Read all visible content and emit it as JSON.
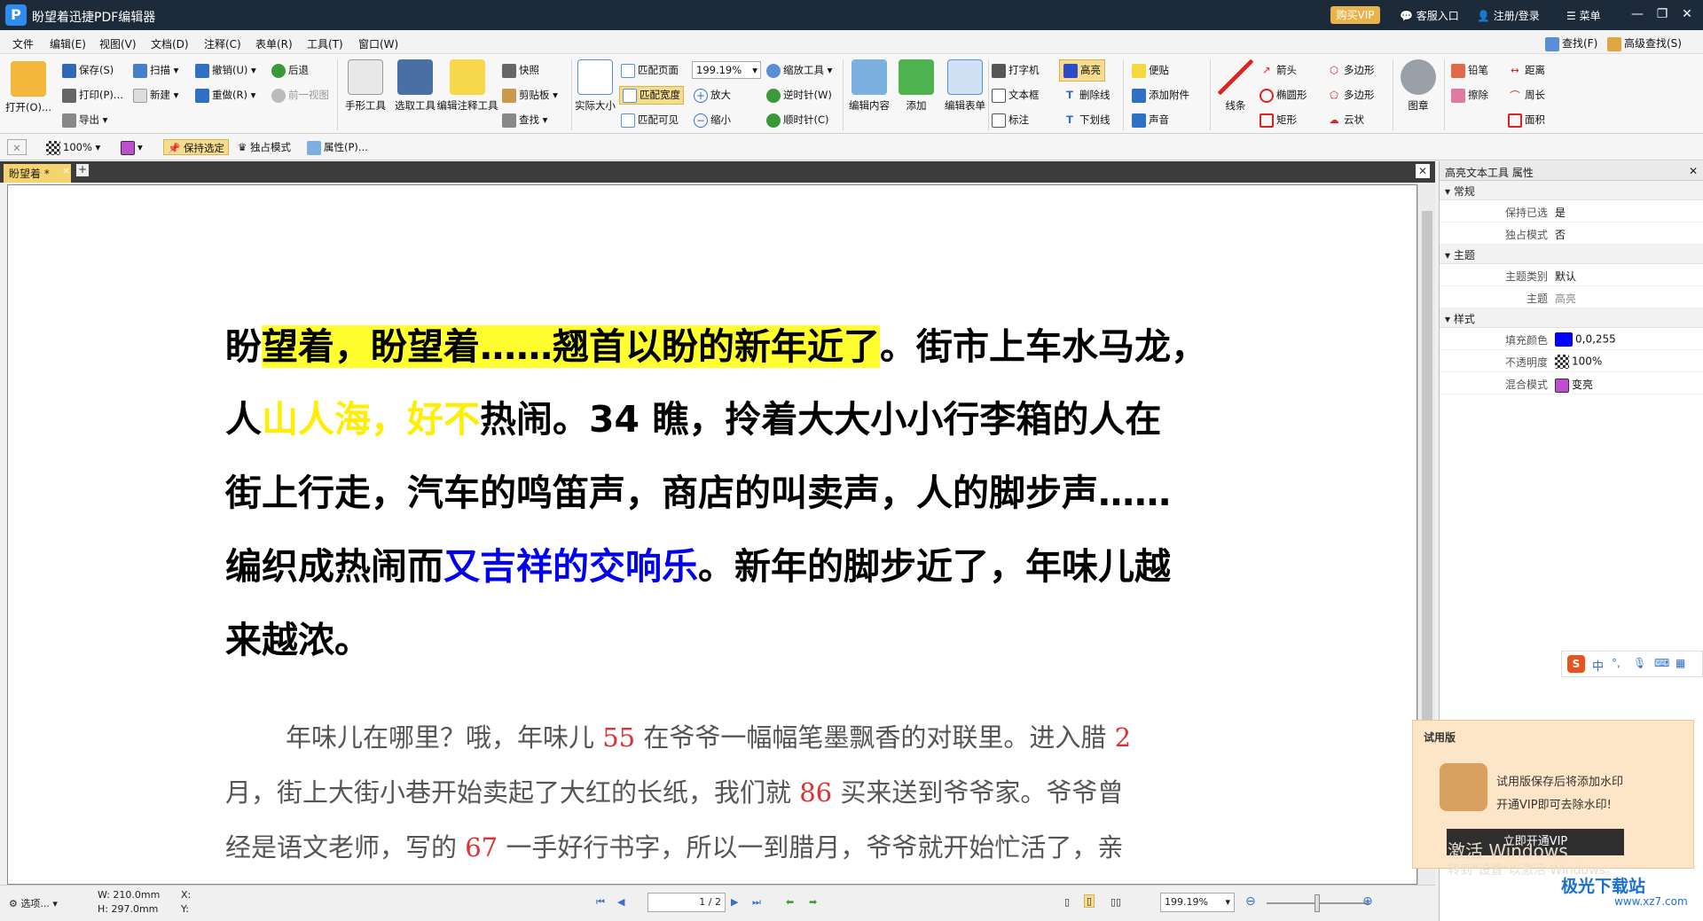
{
  "titlebar": {
    "app_title": "盼望着迅捷PDF编辑器",
    "buy_vip": "购买VIP",
    "support": "客服入口",
    "login": "注册/登录",
    "menu": "菜单"
  },
  "menubar": {
    "items": [
      "文件",
      "编辑(E)",
      "视图(V)",
      "文档(D)",
      "注释(C)",
      "表单(R)",
      "工具(T)",
      "窗口(W)"
    ],
    "find": "查找(F)",
    "advanced_find": "高级查找(S)"
  },
  "ribbon": {
    "open": "打开(O)...",
    "save": "保存(S)",
    "print": "打印(P)...",
    "export": "导出",
    "scan": "扫描",
    "new": "新建",
    "undo": "撤销(U)",
    "redo": "重做(R)",
    "back": "后退",
    "prev_view": "前一视图",
    "hand_tool": "手形工具",
    "select_tool": "选取工具",
    "edit_annot_tool": "编辑注释工具",
    "snapshot": "快照",
    "clipboard": "剪贴板",
    "find": "查找",
    "actual_size": "实际大小",
    "fit_page": "匹配页面",
    "fit_width": "匹配宽度",
    "fit_visible": "匹配可见",
    "zoom_value": "199.19%",
    "zoom_in": "放大",
    "zoom_out": "缩小",
    "zoom_tool": "缩放工具",
    "rotate_ccw": "逆时针(W)",
    "rotate_cw": "顺时针(C)",
    "edit_content": "编辑内容",
    "add": "添加",
    "edit_form": "编辑表单",
    "typewriter": "打字机",
    "textbox": "文本框",
    "callout": "标注",
    "highlight": "高亮",
    "strikeout": "删除线",
    "underline": "下划线",
    "note": "便贴",
    "attach": "添加附件",
    "sound": "声音",
    "lines": "线条",
    "arrow": "箭头",
    "ellipse": "椭圆形",
    "rect": "矩形",
    "polygon": "多边形",
    "polyline": "多边形",
    "cloud": "云状",
    "stamp": "图章",
    "pencil": "铅笔",
    "eraser": "擦除",
    "distance": "距离",
    "perimeter": "周长",
    "area": "面积"
  },
  "prop_toolbar": {
    "opacity": "100%",
    "keep_selected": "保持选定",
    "exclusive_mode": "独占模式",
    "properties": "属性(P)..."
  },
  "doc_tab": {
    "label": "盼望着 *"
  },
  "document": {
    "line1_pre": "盼",
    "line1_hl": "望着，盼望着……翘首以盼的新年近了",
    "line1_post": "。街市上车水马龙，",
    "line2_pre": "人",
    "line2_yel": "山人海，好不",
    "line2_post": "热闹。34 瞧，拎着大大小小行李箱的人在",
    "line3": "街上行走，汽车的鸣笛声，商店的叫卖声，人的脚步声……",
    "line4_pre": "编织成热闹而",
    "line4_blue": "又吉祥的交响乐",
    "line4_post": "。新年的脚步近了，年味儿越",
    "line5": "来越浓。",
    "p1_a": "年味儿在哪里？哦，年味儿 ",
    "p1_n1": "55",
    "p1_b": " 在爷爷一幅幅笔墨飘香的对联里。进入腊 ",
    "p1_n2": "2",
    "p2_a": "月，街上大街小巷开始卖起了大红的长纸，我们就 ",
    "p2_n": "86",
    "p2_b": " 买来送到爷爷家。爷爷曾",
    "p3_a": "经是语文老师，写的 ",
    "p3_n": "67",
    "p3_b": " 一手好行书字，所以一到腊月，爷爷就开始忙活了，亲"
  },
  "statusbar": {
    "options": "选项...",
    "width": "W: 210.0mm",
    "height": "H: 297.0mm",
    "x": "X:",
    "y": "Y:",
    "page": "1",
    "page_total": "/ 2",
    "zoom": "199.19%"
  },
  "right_panel": {
    "title": "高亮文本工具 属性",
    "groups": [
      {
        "name": "常规",
        "rows": [
          {
            "k": "保持已选",
            "v": "是"
          },
          {
            "k": "独占模式",
            "v": "否"
          }
        ]
      },
      {
        "name": "主题",
        "rows": [
          {
            "k": "主题类别",
            "v": "默认"
          },
          {
            "k": "主题",
            "v": "高亮"
          }
        ]
      },
      {
        "name": "样式",
        "rows": [
          {
            "k": "填充颜色",
            "v": "0,0,255"
          },
          {
            "k": "不透明度",
            "v": "100%"
          },
          {
            "k": "混合模式",
            "v": "变亮"
          }
        ]
      }
    ],
    "fill_color": "#0000ff"
  },
  "ime": {
    "label": "中"
  },
  "trial": {
    "title": "试用版",
    "line1": "试用版保存后将添加水印",
    "line2": "开通VIP即可去除水印!",
    "button": "立即开通VIP"
  },
  "windows_watermark": {
    "line1": "激活 Windows",
    "line2": "转到\"设置\"以激活 Windows。"
  },
  "site_watermark": {
    "name": "极光下载站",
    "url": "www.xz7.com"
  },
  "colors": {
    "titlebar": "#1d2a3a",
    "highlight_yellow": "#ffff30",
    "blue_text": "#0000ee",
    "red_number": "#e23030",
    "tab": "#f5d36e"
  }
}
